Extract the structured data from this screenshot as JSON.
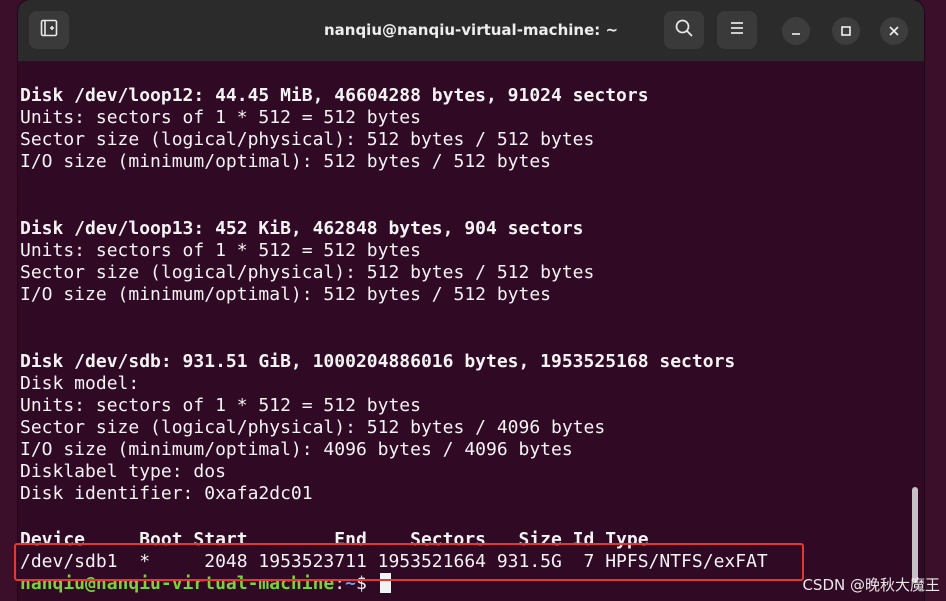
{
  "window": {
    "title": "nanqiu@nanqiu-virtual-machine: ~"
  },
  "toolbar": {
    "new_tab_icon": "new-tab-icon",
    "search_icon": "search-icon",
    "menu_icon": "hamburger-menu-icon",
    "minimize_icon": "minimize-icon",
    "maximize_icon": "maximize-icon",
    "close_icon": "close-icon"
  },
  "terminal": {
    "loop12": {
      "header": "Disk /dev/loop12: 44.45 MiB, 46604288 bytes, 91024 sectors",
      "units": "Units: sectors of 1 * 512 = 512 bytes",
      "sector_size": "Sector size (logical/physical): 512 bytes / 512 bytes",
      "io_size": "I/O size (minimum/optimal): 512 bytes / 512 bytes"
    },
    "loop13": {
      "header": "Disk /dev/loop13: 452 KiB, 462848 bytes, 904 sectors",
      "units": "Units: sectors of 1 * 512 = 512 bytes",
      "sector_size": "Sector size (logical/physical): 512 bytes / 512 bytes",
      "io_size": "I/O size (minimum/optimal): 512 bytes / 512 bytes"
    },
    "sdb": {
      "header": "Disk /dev/sdb: 931.51 GiB, 1000204886016 bytes, 1953525168 sectors",
      "model": "Disk model:",
      "units": "Units: sectors of 1 * 512 = 512 bytes",
      "sector_size": "Sector size (logical/physical): 512 bytes / 4096 bytes",
      "io_size": "I/O size (minimum/optimal): 4096 bytes / 4096 bytes",
      "label_type": "Disklabel type: dos",
      "identifier": "Disk identifier: 0xafa2dc01"
    },
    "partition_table": {
      "header": "Device     Boot Start        End    Sectors   Size Id Type",
      "row": "/dev/sdb1  *     2048 1953523711 1953521664 931.5G  7 HPFS/NTFS/exFAT"
    },
    "prompt": {
      "user_host": "nanqiu@nanqiu-virtual-machine",
      "separator": ":",
      "path": "~",
      "symbol": "$ "
    }
  },
  "watermark": "CSDN @晚秋大魔王"
}
